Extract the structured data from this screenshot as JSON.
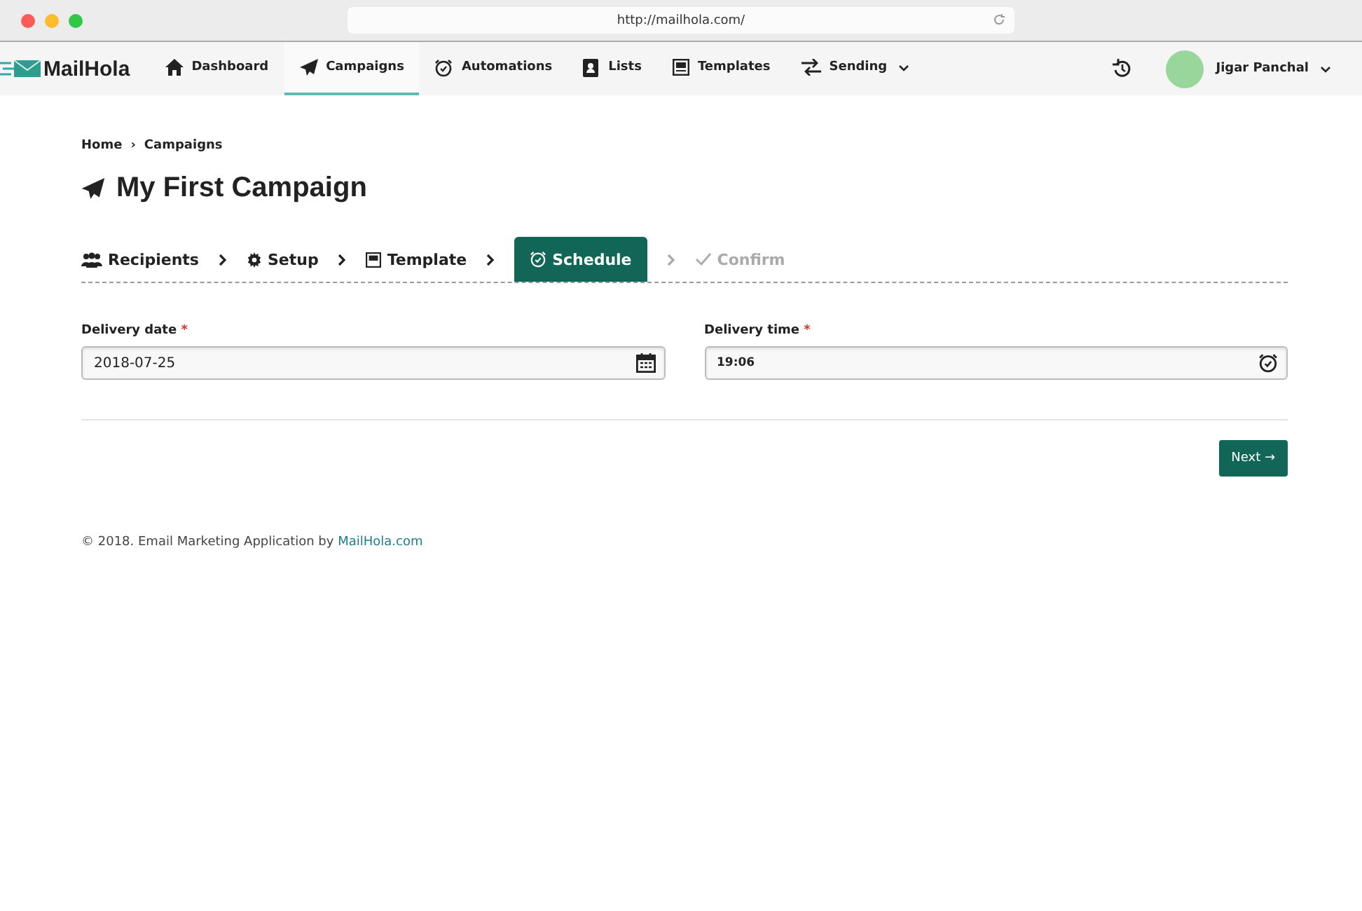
{
  "browser": {
    "url": "http://mailhola.com/"
  },
  "navbar": {
    "logo": "MailHola",
    "items": [
      {
        "label": "Dashboard",
        "kind": "home",
        "selected": false,
        "dropdown": false
      },
      {
        "label": "Campaigns",
        "kind": "plane",
        "selected": true,
        "dropdown": false
      },
      {
        "label": "Automations",
        "kind": "alarm",
        "selected": false,
        "dropdown": false
      },
      {
        "label": "Lists",
        "kind": "book",
        "selected": false,
        "dropdown": false
      },
      {
        "label": "Templates",
        "kind": "template",
        "selected": false,
        "dropdown": false
      },
      {
        "label": "Sending",
        "kind": "arrows",
        "selected": false,
        "dropdown": true
      }
    ],
    "user": {
      "name": "Jigar Panchal"
    }
  },
  "breadcrumb": [
    {
      "label": "Home",
      "separator": "›"
    },
    {
      "label": "Campaigns"
    }
  ],
  "title": "My First Campaign",
  "steps": [
    {
      "label": "Recipients",
      "kind": "users",
      "selected": false,
      "disabled": false
    },
    {
      "label": "Setup",
      "kind": "gear",
      "selected": false,
      "disabled": false
    },
    {
      "label": "Template",
      "kind": "template",
      "selected": false,
      "disabled": false
    },
    {
      "label": "Schedule",
      "kind": "alarm",
      "selected": true,
      "disabled": false
    },
    {
      "label": "Confirm",
      "kind": "check",
      "selected": false,
      "disabled": true
    }
  ],
  "fields": [
    {
      "label": "Delivery date",
      "required_mark": "*",
      "value": "2018-07-25",
      "kind": "calendar"
    },
    {
      "label": "Delivery time",
      "required_mark": "*",
      "value": "19:06",
      "kind": "alarm"
    }
  ],
  "next_button": "Next →",
  "footer": {
    "text": "© 2018. Email Marketing Application by ",
    "link": "MailHola.com"
  }
}
